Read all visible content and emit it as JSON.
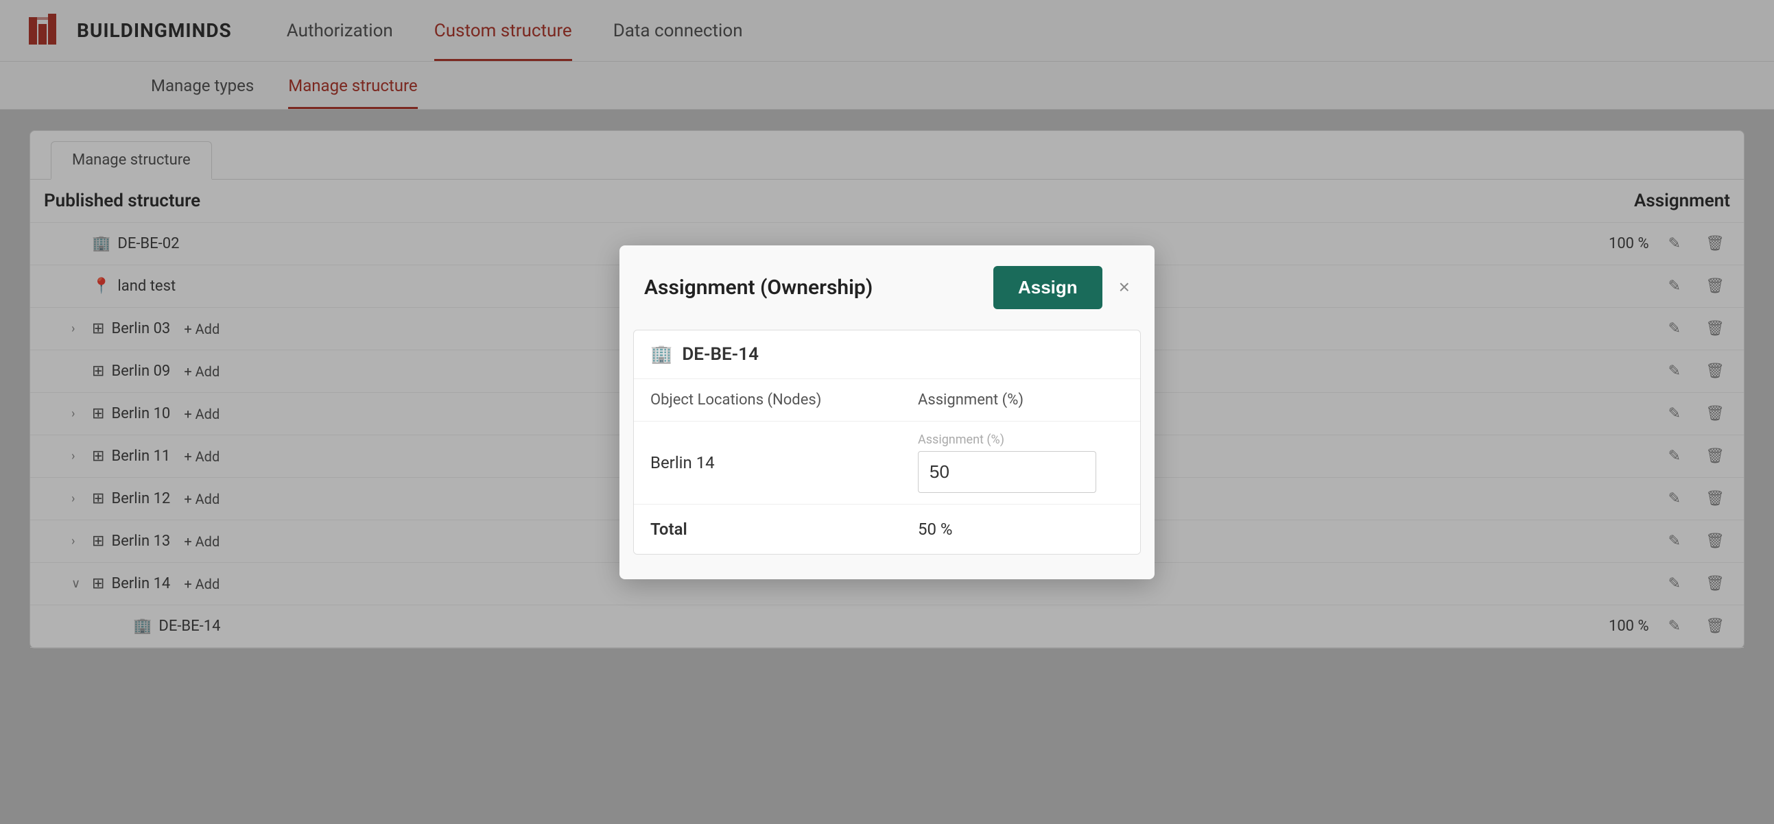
{
  "app": {
    "name": "BUILDINGMINDS"
  },
  "nav": {
    "items": [
      {
        "label": "Authorization",
        "active": false
      },
      {
        "label": "Custom structure",
        "active": true
      },
      {
        "label": "Data connection",
        "active": false
      }
    ]
  },
  "subnav": {
    "items": [
      {
        "label": "Manage types",
        "active": false
      },
      {
        "label": "Manage structure",
        "active": true
      }
    ]
  },
  "card": {
    "tab_label": "Manage structure",
    "table": {
      "header_left": "Published structure",
      "header_right": "Assignment",
      "rows": [
        {
          "indent": 1,
          "expand": "",
          "icon": "building",
          "label": "DE-BE-02",
          "pct": "100 %",
          "has_pct": true
        },
        {
          "indent": 1,
          "expand": "",
          "icon": "land",
          "label": "land test",
          "pct": "",
          "has_pct": false
        },
        {
          "indent": 1,
          "expand": "›",
          "icon": "hierarchy",
          "label": "Berlin 03",
          "add": "+ Add",
          "pct": "",
          "has_pct": false
        },
        {
          "indent": 1,
          "expand": "",
          "icon": "hierarchy",
          "label": "Berlin 09",
          "add": "+ Add",
          "pct": "",
          "has_pct": false
        },
        {
          "indent": 1,
          "expand": "›",
          "icon": "hierarchy",
          "label": "Berlin 10",
          "add": "+ Add",
          "pct": "",
          "has_pct": false
        },
        {
          "indent": 1,
          "expand": "›",
          "icon": "hierarchy",
          "label": "Berlin 11",
          "add": "+ Add",
          "pct": "",
          "has_pct": false
        },
        {
          "indent": 1,
          "expand": "›",
          "icon": "hierarchy",
          "label": "Berlin 12",
          "add": "+ Add",
          "pct": "",
          "has_pct": false
        },
        {
          "indent": 1,
          "expand": "›",
          "icon": "hierarchy",
          "label": "Berlin 13",
          "add": "+ Add",
          "pct": "",
          "has_pct": false
        },
        {
          "indent": 1,
          "expand": "∨",
          "icon": "hierarchy",
          "label": "Berlin 14",
          "add": "+ Add",
          "pct": "",
          "has_pct": false
        },
        {
          "indent": 2,
          "expand": "",
          "icon": "building",
          "label": "DE-BE-14",
          "pct": "100 %",
          "has_pct": true
        }
      ]
    }
  },
  "modal": {
    "title": "Assignment (Ownership)",
    "assign_label": "Assign",
    "close_label": "×",
    "building_icon": "building",
    "building_name": "DE-BE-14",
    "col_left": "Object Locations (Nodes)",
    "col_right": "Assignment (%)",
    "rows": [
      {
        "label": "Berlin 14",
        "input_placeholder": "Assignment (%)",
        "input_value": "50"
      }
    ],
    "total_label": "Total",
    "total_value": "50 %"
  },
  "icons": {
    "building": "🏢",
    "land": "📍",
    "hierarchy": "⚙",
    "edit": "✎",
    "delete": "🗑"
  }
}
